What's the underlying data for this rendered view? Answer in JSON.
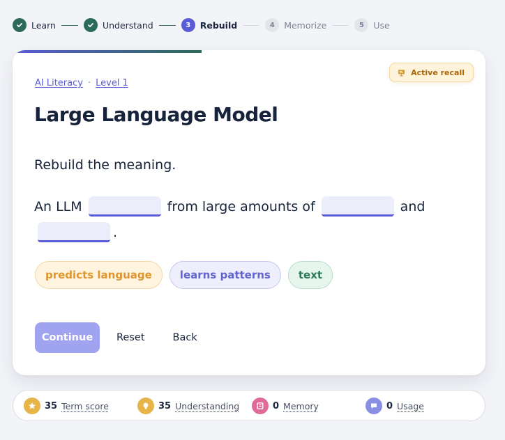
{
  "stepper": {
    "steps": [
      {
        "number": "1",
        "label": "Learn",
        "state": "done"
      },
      {
        "number": "2",
        "label": "Understand",
        "state": "done"
      },
      {
        "number": "3",
        "label": "Rebuild",
        "state": "active"
      },
      {
        "number": "4",
        "label": "Memorize",
        "state": "todo"
      },
      {
        "number": "5",
        "label": "Use",
        "state": "todo"
      }
    ]
  },
  "card": {
    "progress_fraction": 0.4,
    "badge": "Active recall",
    "breadcrumb": [
      "AI Literacy",
      "Level 1"
    ],
    "breadcrumb_separator": "·",
    "title": "Large Language Model",
    "prompt": "Rebuild the meaning.",
    "sentence": {
      "part1": "An LLM",
      "part2": "from large amounts of",
      "part3": "and",
      "part4": "."
    },
    "chips": [
      "predicts language",
      "learns patterns",
      "text"
    ],
    "actions": {
      "continue": "Continue",
      "reset": "Reset",
      "back": "Back"
    }
  },
  "stats": [
    {
      "value": "35",
      "label": "Term score",
      "color": "#e5b54a",
      "icon": "star-icon"
    },
    {
      "value": "35",
      "label": "Understanding",
      "color": "#e5b54a",
      "icon": "lightbulb-icon"
    },
    {
      "value": "0",
      "label": "Memory",
      "color": "#e06a98",
      "icon": "card-icon"
    },
    {
      "value": "0",
      "label": "Usage",
      "color": "#8b8fe3",
      "icon": "chat-icon"
    }
  ],
  "colors": {
    "accent": "#5a5bd6",
    "done": "#2b6b57",
    "badge_text": "#a8670a"
  }
}
